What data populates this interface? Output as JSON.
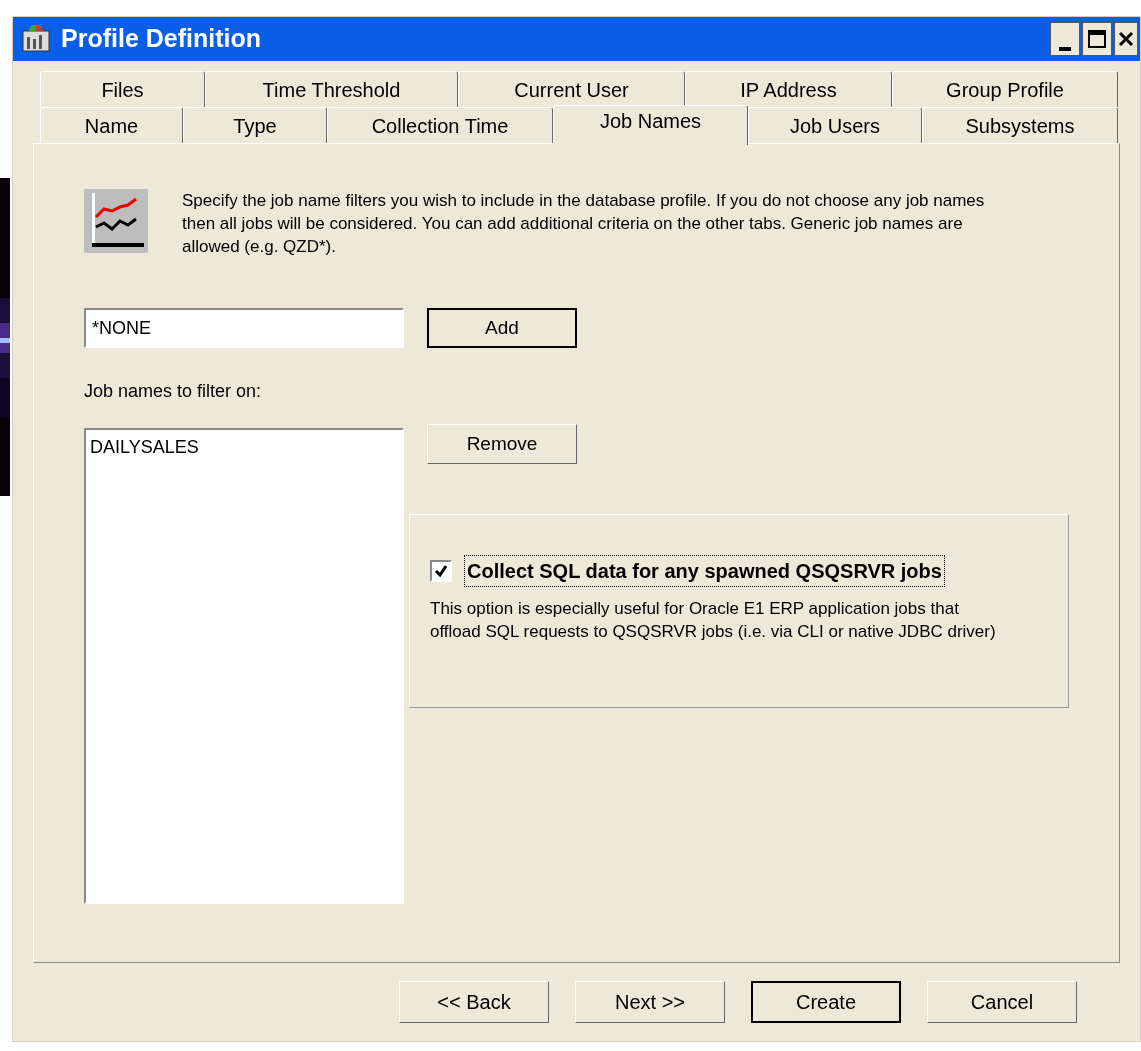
{
  "window": {
    "title": "Profile Definition"
  },
  "tab_rows": [
    [
      {
        "label": "Files",
        "selected": false
      },
      {
        "label": "Time Threshold",
        "selected": false
      },
      {
        "label": "Current User",
        "selected": false
      },
      {
        "label": "IP Address",
        "selected": false
      },
      {
        "label": "Group Profile",
        "selected": false
      }
    ],
    [
      {
        "label": "Name",
        "selected": false
      },
      {
        "label": "Type",
        "selected": false
      },
      {
        "label": "Collection Time",
        "selected": false
      },
      {
        "label": "Job Names",
        "selected": true
      },
      {
        "label": "Job Users",
        "selected": false
      },
      {
        "label": "Subsystems",
        "selected": false
      }
    ]
  ],
  "description": "Specify the job name filters you wish to include in the database profile. If you do not choose any job names then all jobs will be considered. You can add additional criteria on the other tabs. Generic job names are allowed (e.g. QZD*).",
  "job_name_field": {
    "value": "*NONE"
  },
  "add_button": "Add",
  "list_label": "Job names to filter on:",
  "job_names": [
    "DAILYSALES"
  ],
  "remove_button": "Remove",
  "sql_option": {
    "label": "Collect SQL data for any spawned QSQSRVR jobs",
    "checked": true,
    "note": "This option is especially useful for Oracle E1 ERP application jobs that offload SQL requests to QSQSRVR jobs (i.e. via CLI or native JDBC driver)"
  },
  "buttons": [
    {
      "label": "<< Back",
      "default": false
    },
    {
      "label": "Next >>",
      "default": false
    },
    {
      "label": "Create",
      "default": true
    },
    {
      "label": "Cancel",
      "default": false
    }
  ]
}
